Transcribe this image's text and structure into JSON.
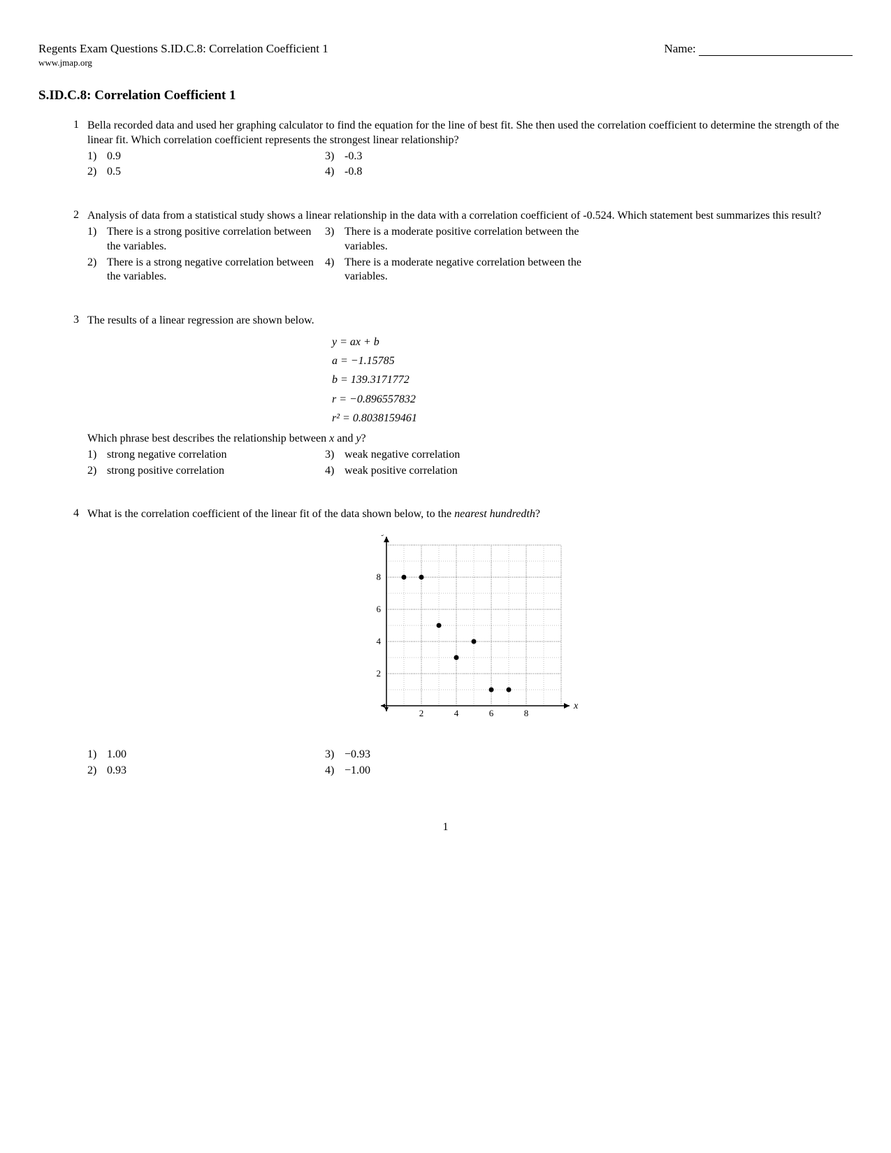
{
  "header": {
    "left": "Regents Exam Questions S.ID.C.8: Correlation Coefficient 1",
    "name_label": "Name:",
    "url": "www.jmap.org"
  },
  "title": "S.ID.C.8: Correlation Coefficient 1",
  "questions": [
    {
      "num": "1",
      "prompt": "Bella recorded data and used her graphing calculator to find the equation for the line of best fit.  She then used the correlation coefficient to determine the strength of the linear fit.  Which correlation coefficient represents the strongest linear relationship?",
      "choices": [
        {
          "n": "1)",
          "t": "0.9"
        },
        {
          "n": "2)",
          "t": "0.5"
        },
        {
          "n": "3)",
          "t": "-0.3"
        },
        {
          "n": "4)",
          "t": "-0.8"
        }
      ]
    },
    {
      "num": "2",
      "prompt": "Analysis of data from a statistical study shows a linear relationship in the data with a correlation coefficient of -0.524.  Which statement best summarizes this result?",
      "choices": [
        {
          "n": "1)",
          "t": "There is a strong positive correlation between the variables."
        },
        {
          "n": "2)",
          "t": "There is a strong negative correlation between the variables."
        },
        {
          "n": "3)",
          "t": "There is a moderate positive correlation between the variables."
        },
        {
          "n": "4)",
          "t": "There is a moderate negative correlation between the variables."
        }
      ]
    },
    {
      "num": "3",
      "prompt_before": "The results of a linear regression are shown below.",
      "regression": {
        "eq": "y = ax + b",
        "a": "a = −1.15785",
        "b": "b = 139.3171772",
        "r": "r = −0.896557832",
        "r2": "r² = 0.8038159461"
      },
      "prompt_after": "Which phrase best describes the relationship between x and y?",
      "choices": [
        {
          "n": "1)",
          "t": "strong negative correlation"
        },
        {
          "n": "2)",
          "t": "strong positive correlation"
        },
        {
          "n": "3)",
          "t": "weak negative correlation"
        },
        {
          "n": "4)",
          "t": "weak positive correlation"
        }
      ]
    },
    {
      "num": "4",
      "prompt_before": "What is the correlation coefficient of the linear fit of the data shown below, to the ",
      "prompt_italic": "nearest hundredth",
      "prompt_after": "?",
      "choices": [
        {
          "n": "1)",
          "t": "1.00"
        },
        {
          "n": "2)",
          "t": "0.93"
        },
        {
          "n": "3)",
          "t": "−0.93"
        },
        {
          "n": "4)",
          "t": "−1.00"
        }
      ]
    }
  ],
  "chart_data": {
    "type": "scatter",
    "title": "",
    "xlabel": "x",
    "ylabel": "y",
    "xlim": [
      0,
      10
    ],
    "ylim": [
      0,
      10
    ],
    "xticks": [
      2,
      4,
      6,
      8
    ],
    "yticks": [
      2,
      4,
      6,
      8
    ],
    "points": [
      {
        "x": 1,
        "y": 8
      },
      {
        "x": 2,
        "y": 8
      },
      {
        "x": 3,
        "y": 5
      },
      {
        "x": 4,
        "y": 3
      },
      {
        "x": 5,
        "y": 4
      },
      {
        "x": 6,
        "y": 1
      },
      {
        "x": 7,
        "y": 1
      }
    ]
  },
  "page_number": "1"
}
